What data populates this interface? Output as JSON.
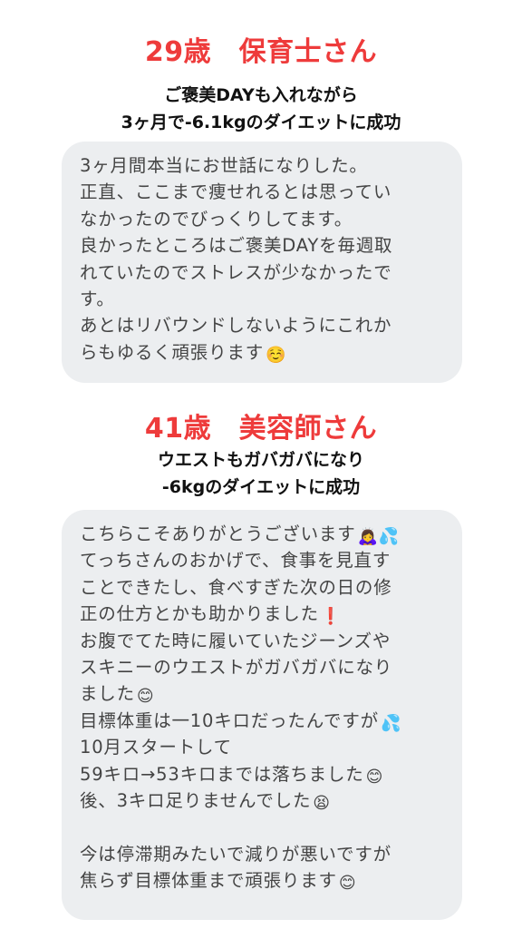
{
  "sections": [
    {
      "title": "29歳　保育士さん",
      "subtitle_lines": [
        "ご褒美DAYも入れながら",
        "3ヶ月で-6.1kgのダイエットに成功"
      ],
      "message_lines": [
        {
          "text": "3ヶ月間本当にお世話になりした。",
          "emoji": ""
        },
        {
          "text": "正直、ここまで痩せれるとは思ってい",
          "emoji": ""
        },
        {
          "text": "なかったのでびっくりしてます。",
          "emoji": ""
        },
        {
          "text": "良かったところはご褒美DAYを毎週取",
          "emoji": ""
        },
        {
          "text": "れていたのでストレスが少なかったで",
          "emoji": ""
        },
        {
          "text": "す。",
          "emoji": ""
        },
        {
          "text": "あとはリバウンドしないようにこれか",
          "emoji": ""
        },
        {
          "text": "らもゆるく頑張ります",
          "emoji": "☺️"
        }
      ]
    },
    {
      "title": "41歳　美容師さん",
      "subtitle_lines": [
        "ウエストもガバガバになり",
        "-6kgのダイエットに成功"
      ],
      "message_lines": [
        {
          "text": "こちらこそありがとうございます",
          "emoji": "🙇‍♀️💦"
        },
        {
          "text": "てっちさんのおかげで、食事を見直す",
          "emoji": ""
        },
        {
          "text": "ことできたし、食べすぎた次の日の修",
          "emoji": ""
        },
        {
          "text": "正の仕方とかも助かりました",
          "emoji": "❗"
        },
        {
          "text": "お腹でてた時に履いていたジーンズや",
          "emoji": ""
        },
        {
          "text": "スキニーのウエストがガバガバになり",
          "emoji": ""
        },
        {
          "text": "ました",
          "emoji": "😊"
        },
        {
          "text": "目標体重は一10キロだったんですが",
          "emoji": "💦"
        },
        {
          "text": "10月スタートして",
          "emoji": ""
        },
        {
          "text": "59キロ→53キロまでは落ちました",
          "emoji": "😊"
        },
        {
          "text": "後、3キロ足りませんでした",
          "emoji": "😫"
        },
        {
          "text": "",
          "emoji": ""
        },
        {
          "text": "今は停滞期みたいで減りが悪いですが",
          "emoji": ""
        },
        {
          "text": "焦らず目標体重まで頑張ります",
          "emoji": "😊"
        }
      ]
    }
  ],
  "colors": {
    "title": "#ee3b3b",
    "subtitle": "#111111",
    "bubble_bg": "#eceef0",
    "bubble_text": "#444444",
    "background": "#ffffff"
  }
}
